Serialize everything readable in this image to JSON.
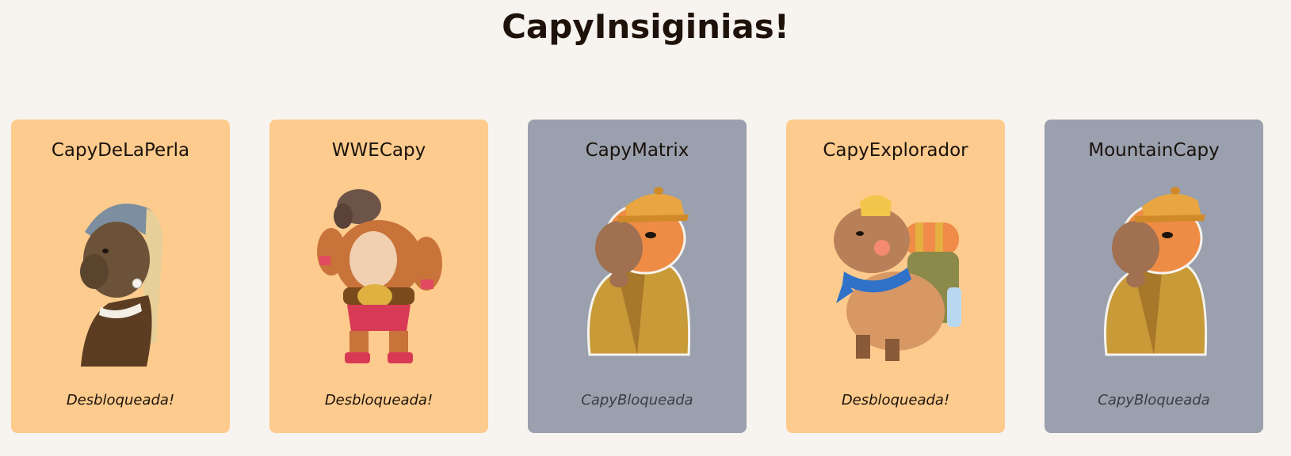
{
  "page": {
    "title": "CapyInsiginias!"
  },
  "badges": [
    {
      "name": "CapyDeLaPerla",
      "status": "Desbloqueada!",
      "locked": false,
      "icon": "capybara-pearl-earring-image"
    },
    {
      "name": "WWECapy",
      "status": "Desbloqueada!",
      "locked": false,
      "icon": "capybara-wrestler-image"
    },
    {
      "name": "CapyMatrix",
      "status": "CapyBloqueada",
      "locked": true,
      "icon": "capybara-detective-image"
    },
    {
      "name": "CapyExplorador",
      "status": "Desbloqueada!",
      "locked": false,
      "icon": "capybara-explorer-image"
    },
    {
      "name": "MountainCapy",
      "status": "CapyBloqueada",
      "locked": true,
      "icon": "capybara-detective-image"
    }
  ],
  "colors": {
    "background": "#f7f3ee",
    "unlocked_card": "#fdcb8d",
    "locked_card": "#9aa0ad",
    "text": "#1e120a"
  }
}
